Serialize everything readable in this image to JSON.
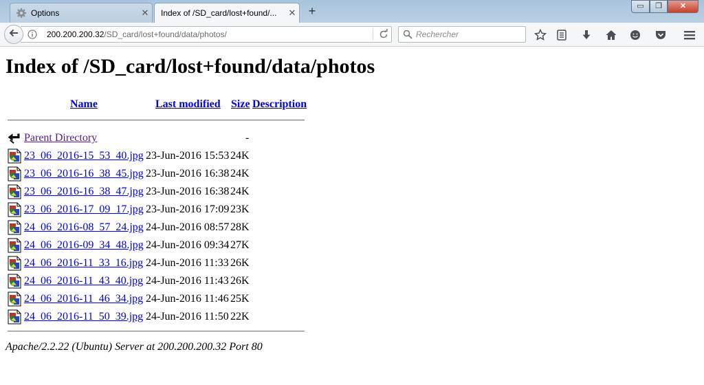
{
  "browser": {
    "tabs": [
      {
        "label": "Options",
        "icon": "gear-icon"
      },
      {
        "label": "Index of /SD_card/lost+found/..."
      }
    ],
    "url_host": "200.200.200.32",
    "url_path": "/SD_card/lost+found/data/photos/",
    "search_placeholder": "Rechercher",
    "window_controls": {
      "minimize": "▭",
      "maximize": "❐",
      "close": "✕"
    }
  },
  "page": {
    "title": "Index of /SD_card/lost+found/data/photos",
    "columns": {
      "name": "Name",
      "last_modified": "Last modified",
      "size": "Size",
      "description": "Description"
    },
    "parent": {
      "label": "Parent Directory",
      "size": "-"
    },
    "files": [
      {
        "name": "23_06_2016-15_53_40.jpg",
        "modified": "23-Jun-2016 15:53",
        "size": "24K"
      },
      {
        "name": "23_06_2016-16_38_45.jpg",
        "modified": "23-Jun-2016 16:38",
        "size": "24K"
      },
      {
        "name": "23_06_2016-16_38_47.jpg",
        "modified": "23-Jun-2016 16:38",
        "size": "24K"
      },
      {
        "name": "23_06_2016-17_09_17.jpg",
        "modified": "23-Jun-2016 17:09",
        "size": "23K"
      },
      {
        "name": "24_06_2016-08_57_24.jpg",
        "modified": "24-Jun-2016 08:57",
        "size": "28K"
      },
      {
        "name": "24_06_2016-09_34_48.jpg",
        "modified": "24-Jun-2016 09:34",
        "size": "27K"
      },
      {
        "name": "24_06_2016-11_33_16.jpg",
        "modified": "24-Jun-2016 11:33",
        "size": "26K"
      },
      {
        "name": "24_06_2016-11_43_40.jpg",
        "modified": "24-Jun-2016 11:43",
        "size": "26K"
      },
      {
        "name": "24_06_2016-11_46_34.jpg",
        "modified": "24-Jun-2016 11:46",
        "size": "25K"
      },
      {
        "name": "24_06_2016-11_50_39.jpg",
        "modified": "24-Jun-2016 11:50",
        "size": "22K"
      }
    ],
    "footer": "Apache/2.2.22 (Ubuntu) Server at 200.200.200.32 Port 80"
  }
}
